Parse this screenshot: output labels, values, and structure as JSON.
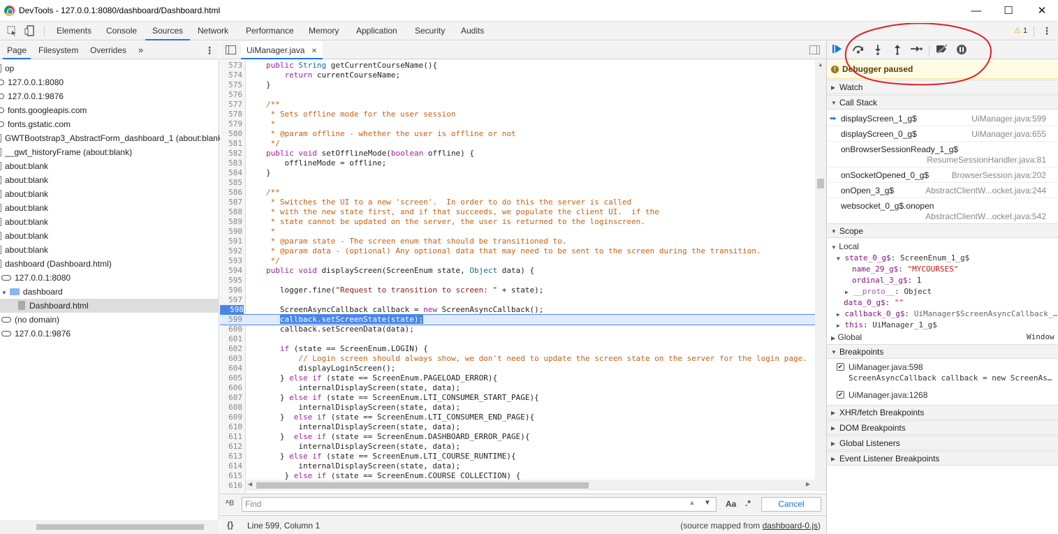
{
  "window": {
    "title": "DevTools - 127.0.0.1:8080/dashboard/Dashboard.html",
    "controls": {
      "minimize": "—",
      "maximize": "☐",
      "close": "✕"
    }
  },
  "main_tabs": [
    "Elements",
    "Console",
    "Sources",
    "Network",
    "Performance",
    "Memory",
    "Application",
    "Security",
    "Audits"
  ],
  "active_main_tab": "Sources",
  "warnings": {
    "icon": "warning-icon",
    "count": "1"
  },
  "navigator": {
    "tabs": [
      "Page",
      "Filesystem",
      "Overrides"
    ],
    "more": "»",
    "tree": [
      {
        "label": "op",
        "type": "frame"
      },
      {
        "label": "127.0.0.1:8080",
        "type": "cloud"
      },
      {
        "label": "127.0.0.1:9876",
        "type": "cloud"
      },
      {
        "label": "fonts.googleapis.com",
        "type": "cloud"
      },
      {
        "label": "fonts.gstatic.com",
        "type": "cloud"
      },
      {
        "label": "GWTBootstrap3_AbstractForm_dashboard_1 (about:blank)",
        "type": "frame"
      },
      {
        "label": "__gwt_historyFrame (about:blank)",
        "type": "frame"
      },
      {
        "label": "about:blank",
        "type": "frame"
      },
      {
        "label": "about:blank",
        "type": "frame"
      },
      {
        "label": "about:blank",
        "type": "frame"
      },
      {
        "label": "about:blank",
        "type": "frame"
      },
      {
        "label": "about:blank",
        "type": "frame"
      },
      {
        "label": "about:blank",
        "type": "frame"
      },
      {
        "label": "about:blank",
        "type": "frame"
      },
      {
        "label": "dashboard (Dashboard.html)",
        "type": "frame"
      },
      {
        "label": "127.0.0.1:8080",
        "type": "cloud"
      },
      {
        "label": "dashboard",
        "type": "folder"
      },
      {
        "label": "Dashboard.html",
        "type": "file",
        "selected": true
      },
      {
        "label": "(no domain)",
        "type": "cloud"
      },
      {
        "label": "127.0.0.1:9876",
        "type": "cloud"
      }
    ]
  },
  "editor": {
    "tab": "UiManager.java",
    "tab_close": "✕",
    "lines": [
      {
        "n": "573",
        "t": "public String getCurrentCourseName(){",
        "k": "code"
      },
      {
        "n": "574",
        "t": "    return currentCourseName;",
        "k": "code"
      },
      {
        "n": "575",
        "t": "}",
        "k": "code"
      },
      {
        "n": "576",
        "t": "",
        "k": "code"
      },
      {
        "n": "577",
        "t": "/**",
        "k": "comment"
      },
      {
        "n": "578",
        "t": " * Sets offline mode for the user session",
        "k": "comment"
      },
      {
        "n": "579",
        "t": " *",
        "k": "comment"
      },
      {
        "n": "580",
        "t": " * @param offline - whether the user is offline or not",
        "k": "comment"
      },
      {
        "n": "581",
        "t": " */",
        "k": "comment"
      },
      {
        "n": "582",
        "t": "public void setOfflineMode(boolean offline) {",
        "k": "code"
      },
      {
        "n": "583",
        "t": "    offlineMode = offline;",
        "k": "code"
      },
      {
        "n": "584",
        "t": "}",
        "k": "code"
      },
      {
        "n": "585",
        "t": "",
        "k": "code"
      },
      {
        "n": "586",
        "t": "/**",
        "k": "comment"
      },
      {
        "n": "587",
        "t": " * Switches the UI to a new 'screen'.  In order to do this the server is called",
        "k": "comment"
      },
      {
        "n": "588",
        "t": " * with the new state first, and if that succeeds, we populate the client UI.  if the",
        "k": "comment"
      },
      {
        "n": "589",
        "t": " * state cannot be updated on the server, the user is returned to the loginscreen.",
        "k": "comment"
      },
      {
        "n": "590",
        "t": " *",
        "k": "comment"
      },
      {
        "n": "591",
        "t": " * @param state - The screen enum that should be transitioned to.",
        "k": "comment"
      },
      {
        "n": "592",
        "t": " * @param data - (optional) Any optional data that may need to be sent to the screen during the transition.",
        "k": "comment"
      },
      {
        "n": "593",
        "t": " */",
        "k": "comment"
      },
      {
        "n": "594",
        "t": "public void displayScreen(ScreenEnum state, Object data) {",
        "k": "code"
      },
      {
        "n": "595",
        "t": "",
        "k": "code"
      },
      {
        "n": "596",
        "t": "   logger.fine(\"Request to transition to screen: \" + state);",
        "k": "code"
      },
      {
        "n": "597",
        "t": "",
        "k": "code"
      },
      {
        "n": "598",
        "t": "   ScreenAsyncCallback callback = new ScreenAsyncCallback();",
        "k": "breakpoint"
      },
      {
        "n": "599",
        "t": "   callback.setScreenState(state);",
        "k": "current"
      },
      {
        "n": "600",
        "t": "   callback.setScreenData(data);",
        "k": "code"
      },
      {
        "n": "601",
        "t": "",
        "k": "code"
      },
      {
        "n": "602",
        "t": "   if (state == ScreenEnum.LOGIN) {",
        "k": "code"
      },
      {
        "n": "603",
        "t": "       // Login screen should always show, we don't need to update the screen state on the server for the login page.",
        "k": "comment"
      },
      {
        "n": "604",
        "t": "       displayLoginScreen();",
        "k": "code"
      },
      {
        "n": "605",
        "t": "   } else if (state == ScreenEnum.PAGELOAD_ERROR){",
        "k": "code"
      },
      {
        "n": "606",
        "t": "       internalDisplayScreen(state, data);",
        "k": "code"
      },
      {
        "n": "607",
        "t": "   } else if (state == ScreenEnum.LTI_CONSUMER_START_PAGE){",
        "k": "code"
      },
      {
        "n": "608",
        "t": "       internalDisplayScreen(state, data);",
        "k": "code"
      },
      {
        "n": "609",
        "t": "   }  else if (state == ScreenEnum.LTI_CONSUMER_END_PAGE){",
        "k": "code"
      },
      {
        "n": "610",
        "t": "       internalDisplayScreen(state, data);",
        "k": "code"
      },
      {
        "n": "611",
        "t": "   }  else if (state == ScreenEnum.DASHBOARD_ERROR_PAGE){",
        "k": "code"
      },
      {
        "n": "612",
        "t": "       internalDisplayScreen(state, data);",
        "k": "code"
      },
      {
        "n": "613",
        "t": "   } else if (state == ScreenEnum.LTI_COURSE_RUNTIME){",
        "k": "code"
      },
      {
        "n": "614",
        "t": "       internalDisplayScreen(state, data);",
        "k": "code"
      },
      {
        "n": "615",
        "t": "    } else if (state == ScreenEnum.COURSE_COLLECTION) {",
        "k": "code"
      },
      {
        "n": "616",
        "t": "",
        "k": "code"
      }
    ],
    "find": {
      "placeholder": "Find",
      "case_label": "Aa",
      "regex_label": ".*",
      "cancel": "Cancel"
    },
    "status": {
      "braces": "{}",
      "position": "Line 599, Column 1",
      "source_map_prefix": "(source mapped from ",
      "source_map_link": "dashboard-0.js",
      "source_map_suffix": ")"
    }
  },
  "debugger": {
    "paused_message": "Debugger paused",
    "sections": {
      "watch": "Watch",
      "call_stack": "Call Stack",
      "scope": "Scope",
      "breakpoints": "Breakpoints",
      "xhr": "XHR/fetch Breakpoints",
      "dom": "DOM Breakpoints",
      "global_listeners": "Global Listeners",
      "event_listeners": "Event Listener Breakpoints"
    },
    "call_stack": [
      {
        "fn": "displayScreen_1_g$",
        "loc": "UiManager.java:599",
        "current": true
      },
      {
        "fn": "displayScreen_0_g$",
        "loc": "UiManager.java:655"
      },
      {
        "fn": "onBrowserSessionReady_1_g$",
        "loc": "ResumeSessionHandler.java:81"
      },
      {
        "fn": "onSocketOpened_0_g$",
        "loc": "BrowserSession.java:202"
      },
      {
        "fn": "onOpen_3_g$",
        "loc": "AbstractClientW...ocket.java:244"
      },
      {
        "fn": "websocket_0_g$.onopen",
        "loc": "AbstractClientW...ocket.java:542"
      }
    ],
    "scope": {
      "local_label": "Local",
      "state_key": "state_0_g$",
      "state_val": "ScreenEnum_1_g$",
      "name_key": "name_29_g$",
      "name_val": "\"MYCOURSES\"",
      "ordinal_key": "ordinal_3_g$",
      "ordinal_val": "1",
      "proto_key": "__proto__",
      "proto_val": "Object",
      "data_key": "data_0_g$",
      "data_val": "\"\"",
      "callback_key": "callback_0_g$",
      "callback_val": "UiManager$ScreenAsyncCallback_…",
      "this_key": "this",
      "this_val": "UiManager_1_g$",
      "global_label": "Global",
      "global_val": "Window"
    },
    "breakpoints": [
      {
        "file": "UiManager.java:598",
        "code": "ScreenAsyncCallback callback = new ScreenAs…",
        "checked": true
      },
      {
        "file": "UiManager.java:1268",
        "code": "",
        "checked": true
      }
    ]
  },
  "colors": {
    "accent": "#1a73e8",
    "breakpoint": "#4a86e8",
    "annotation": "#e02020",
    "paused_bg": "#fffbe5"
  }
}
